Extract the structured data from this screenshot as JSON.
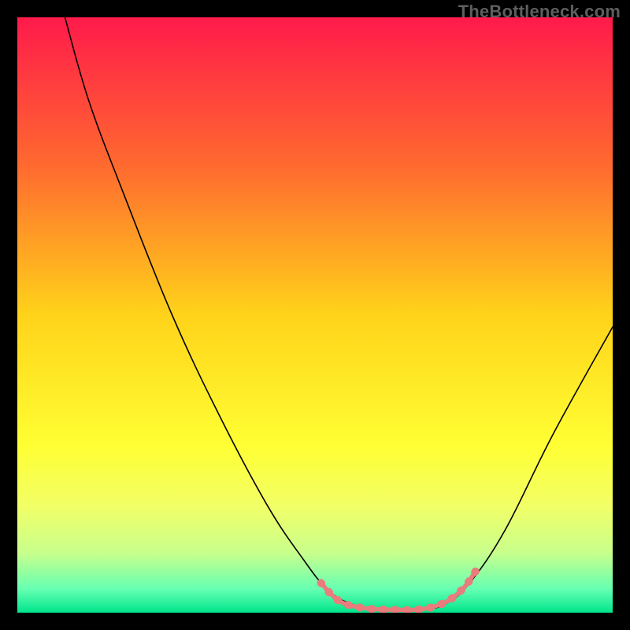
{
  "watermark": {
    "text": "TheBottleneck.com"
  },
  "chart_data": {
    "type": "line",
    "title": "",
    "xlabel": "",
    "ylabel": "",
    "xlim": [
      0,
      100
    ],
    "ylim": [
      0,
      100
    ],
    "grid": false,
    "legend": false,
    "background_gradient": {
      "stops": [
        {
          "offset": 0.0,
          "color": "#ff1a4b"
        },
        {
          "offset": 0.25,
          "color": "#ff6a2f"
        },
        {
          "offset": 0.5,
          "color": "#ffd31a"
        },
        {
          "offset": 0.72,
          "color": "#ffff33"
        },
        {
          "offset": 0.82,
          "color": "#f2ff66"
        },
        {
          "offset": 0.9,
          "color": "#c8ff8c"
        },
        {
          "offset": 0.96,
          "color": "#66ffb2"
        },
        {
          "offset": 1.0,
          "color": "#00e58c"
        }
      ]
    },
    "series": [
      {
        "name": "bottleneck-curve",
        "color": "#000000",
        "width": 1.6,
        "points": [
          {
            "x": 8,
            "y": 100
          },
          {
            "x": 12,
            "y": 86
          },
          {
            "x": 18,
            "y": 70
          },
          {
            "x": 26,
            "y": 50
          },
          {
            "x": 34,
            "y": 33
          },
          {
            "x": 42,
            "y": 18
          },
          {
            "x": 48,
            "y": 9
          },
          {
            "x": 52,
            "y": 4
          },
          {
            "x": 56,
            "y": 1.5
          },
          {
            "x": 62,
            "y": 0.5
          },
          {
            "x": 68,
            "y": 0.5
          },
          {
            "x": 72,
            "y": 1.5
          },
          {
            "x": 76,
            "y": 5
          },
          {
            "x": 82,
            "y": 14
          },
          {
            "x": 90,
            "y": 30
          },
          {
            "x": 100,
            "y": 48
          }
        ]
      },
      {
        "name": "highlighted-bottom",
        "color": "#e97c7c",
        "width": 10,
        "highlight": true,
        "points": [
          {
            "x": 51,
            "y": 5
          },
          {
            "x": 54,
            "y": 2
          },
          {
            "x": 58,
            "y": 0.8
          },
          {
            "x": 63,
            "y": 0.5
          },
          {
            "x": 68,
            "y": 0.6
          },
          {
            "x": 72,
            "y": 1.8
          },
          {
            "x": 75,
            "y": 4.2
          },
          {
            "x": 77,
            "y": 7
          }
        ]
      }
    ]
  }
}
